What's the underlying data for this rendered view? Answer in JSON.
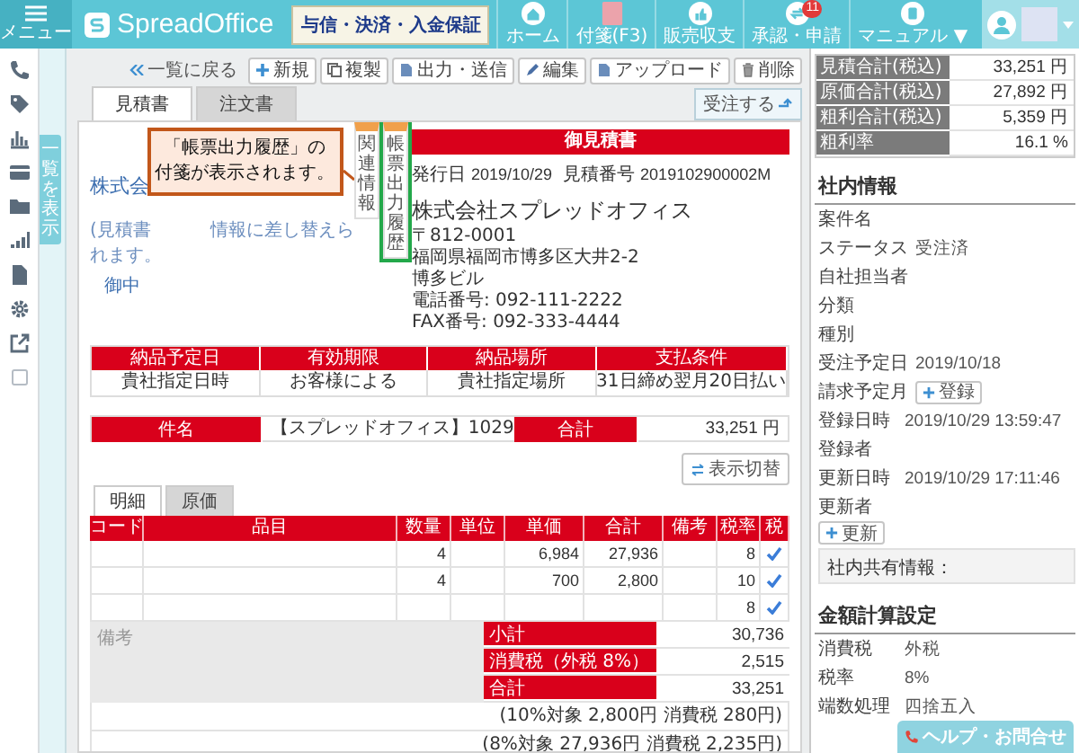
{
  "header": {
    "menu_label": "メニュー",
    "logo": "SpreadOffice",
    "banner": "与信・決済・入金保証",
    "nav": [
      {
        "kind": "home",
        "label": "ホーム"
      },
      {
        "kind": "note",
        "label": "付箋(F3)"
      },
      {
        "kind": "sales",
        "label": "販売収支"
      },
      {
        "kind": "approval",
        "label": "承認・申請",
        "badge": "11"
      },
      {
        "kind": "manual",
        "label": "マニュアル ▼"
      }
    ]
  },
  "list_tab": "一覧を表示",
  "toolbar": {
    "back": "一覧に戻る",
    "buttons": [
      {
        "kind": "plus",
        "label": "新規"
      },
      {
        "kind": "copy",
        "label": "複製"
      },
      {
        "kind": "doc",
        "label": "出力・送信"
      },
      {
        "kind": "pen",
        "label": "編集"
      },
      {
        "kind": "doc",
        "label": "アップロード"
      },
      {
        "kind": "trash",
        "label": "削除"
      }
    ],
    "order_button": "受注する"
  },
  "doc_tabs": [
    {
      "label": "見積書",
      "selected": true
    },
    {
      "label": "注文書",
      "selected": false
    }
  ],
  "callout": "「帳票出力履歴」の付箋が表示されます。",
  "notes": [
    {
      "label": "関連情報",
      "highlighted": false
    },
    {
      "label": "帳票出力履歴",
      "highlighted": true
    }
  ],
  "recipient": {
    "name": "株式会",
    "note_start": "(見積書",
    "note_end": "情報に差し替えら",
    "note_line2": "れます。",
    "honorific": "御中"
  },
  "document": {
    "title": "御見積書",
    "issue_label": "発行日",
    "issue_date": "2019/10/29",
    "number_label": "見積番号",
    "number": "2019102900002M",
    "company": "株式会社スプレッドオフィス",
    "address_lines": [
      "〒812-0001",
      "福岡県福岡市博多区大井2-2",
      "博多ビル",
      "電話番号: 092-111-2222",
      "FAX番号: 092-333-4444"
    ]
  },
  "conditions": {
    "headers": [
      "納品予定日",
      "有効期限",
      "納品場所",
      "支払条件"
    ],
    "values": [
      "貴社指定日時",
      "お客様による",
      "貴社指定場所",
      "31日締め翌月20日払い"
    ]
  },
  "subject": {
    "label": "件名",
    "value": "【スプレッドオフィス】1029",
    "total_label": "合計",
    "total": "33,251 円"
  },
  "view_toggle": "表示切替",
  "detail_tabs": [
    {
      "label": "明細",
      "selected": true
    },
    {
      "label": "原価",
      "selected": false
    }
  ],
  "items_table": {
    "columns": [
      "コード",
      "品目",
      "数量",
      "単位",
      "単価",
      "合計",
      "備考",
      "税率",
      "税"
    ],
    "rows": [
      {
        "quantity": "4",
        "unit_price": "6,984",
        "total": "27,936",
        "tax_rate": "8",
        "taxed": true
      },
      {
        "quantity": "4",
        "unit_price": "700",
        "total": "2,800",
        "tax_rate": "10",
        "taxed": true
      },
      {
        "tax_rate": "8",
        "taxed": true
      }
    ]
  },
  "remarks_label": "備考",
  "totals": [
    {
      "label": "小計",
      "value": "30,736"
    },
    {
      "label": "消費税（外税 8%）",
      "value": "2,515"
    },
    {
      "label": "合計",
      "value": "33,251"
    }
  ],
  "tax_notes": [
    "(10%対象 2,800円 消費税 280円)",
    "(8%対象 27,936円 消費税 2,235円)"
  ],
  "right": {
    "summary": [
      {
        "label": "見積合計(税込)",
        "value": "33,251 円"
      },
      {
        "label": "原価合計(税込)",
        "value": "27,892 円"
      },
      {
        "label": "粗利合計(税込)",
        "value": "5,359 円"
      },
      {
        "label": "粗利率",
        "value": "16.1 %"
      }
    ],
    "internal_title": "社内情報",
    "fields": [
      {
        "label": "案件名"
      },
      {
        "label": "ステータス",
        "value": "受注済"
      },
      {
        "label": "自社担当者"
      },
      {
        "label": "分類"
      },
      {
        "label": "種別"
      },
      {
        "label": "受注予定日",
        "value": "2019/10/18"
      },
      {
        "label": "請求予定月",
        "button": "登録"
      },
      {
        "label": "登録日時",
        "value": "2019/10/29 13:59:47"
      },
      {
        "label": "登録者"
      },
      {
        "label": "更新日時",
        "value": "2019/10/29 17:11:46"
      },
      {
        "label": "更新者"
      }
    ],
    "update_button": "更新",
    "shared_info": "社内共有情報：",
    "calc_title": "金額計算設定",
    "calc_fields": [
      {
        "label": "消費税",
        "value": "外税"
      },
      {
        "label": "税率",
        "value": "8%"
      },
      {
        "label": "端数処理",
        "value": "四捨五入"
      }
    ]
  },
  "help_button": "ヘルプ・お問合せ"
}
